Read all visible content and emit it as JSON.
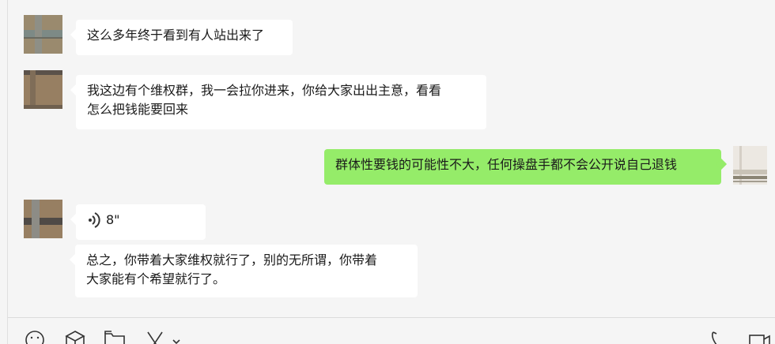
{
  "chat": {
    "messages": [
      {
        "side": "left",
        "type": "text",
        "text": "这么多年终于看到有人站出来了"
      },
      {
        "side": "left",
        "type": "text",
        "line1": "我这边有个维权群，我一会拉你进来，你给大家出出主意，看看",
        "line2": "怎么把钱能要回来"
      },
      {
        "side": "right",
        "type": "text",
        "text": "群体性要钱的可能性不大，任何操盘手都不会公开说自己退钱"
      },
      {
        "side": "left",
        "type": "voice",
        "duration": "8\""
      },
      {
        "side": "left",
        "type": "text",
        "line1": "总之，你带着大家维权就行了，别的无所谓，你带着",
        "line2": "大家能有个希望就行了。"
      }
    ]
  },
  "toolbar": {
    "icons": [
      "emoji-icon",
      "box-icon",
      "folder-icon",
      "scissors-icon",
      "chevron-down-icon",
      "phone-icon",
      "video-icon"
    ]
  },
  "colors": {
    "background": "#f5f5f5",
    "bubble_self": "#95ec69",
    "bubble_other": "#ffffff"
  }
}
